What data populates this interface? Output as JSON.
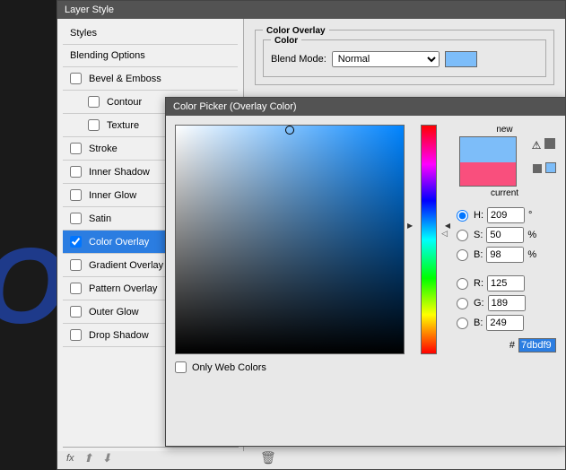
{
  "background_text": "OV",
  "layer_style": {
    "title": "Layer Style",
    "items": [
      {
        "label": "Styles",
        "checkbox": false
      },
      {
        "label": "Blending Options",
        "checkbox": false
      },
      {
        "label": "Bevel & Emboss",
        "checkbox": true,
        "checked": false
      },
      {
        "label": "Contour",
        "checkbox": true,
        "checked": false,
        "sub": true
      },
      {
        "label": "Texture",
        "checkbox": true,
        "checked": false,
        "sub": true
      },
      {
        "label": "Stroke",
        "checkbox": true,
        "checked": false
      },
      {
        "label": "Inner Shadow",
        "checkbox": true,
        "checked": false
      },
      {
        "label": "Inner Glow",
        "checkbox": true,
        "checked": false
      },
      {
        "label": "Satin",
        "checkbox": true,
        "checked": false
      },
      {
        "label": "Color Overlay",
        "checkbox": true,
        "checked": true,
        "selected": true
      },
      {
        "label": "Gradient Overlay",
        "checkbox": true,
        "checked": false
      },
      {
        "label": "Pattern Overlay",
        "checkbox": true,
        "checked": false
      },
      {
        "label": "Outer Glow",
        "checkbox": true,
        "checked": false
      },
      {
        "label": "Drop Shadow",
        "checkbox": true,
        "checked": false
      }
    ],
    "fx_label": "fx",
    "overlay_section": {
      "title": "Color Overlay",
      "subtitle": "Color",
      "blend_mode_label": "Blend Mode:",
      "blend_mode_value": "Normal",
      "swatch_color": "#7dbdf9"
    }
  },
  "color_picker": {
    "title": "Color Picker (Overlay Color)",
    "new_label": "new",
    "current_label": "current",
    "new_color": "#7dbdf9",
    "current_color": "#f94f7d",
    "only_web_label": "Only Web Colors",
    "hue_hint": "◁",
    "fields": {
      "H": {
        "label": "H:",
        "value": "209",
        "unit": "°"
      },
      "S": {
        "label": "S:",
        "value": "50",
        "unit": "%"
      },
      "Bv": {
        "label": "B:",
        "value": "98",
        "unit": "%"
      },
      "R": {
        "label": "R:",
        "value": "125",
        "unit": ""
      },
      "G": {
        "label": "G:",
        "value": "189",
        "unit": ""
      },
      "Bb": {
        "label": "B:",
        "value": "249",
        "unit": ""
      }
    },
    "hex_label": "#",
    "hex_value": "7dbdf9",
    "side_swatch": "#7dbdf9"
  }
}
